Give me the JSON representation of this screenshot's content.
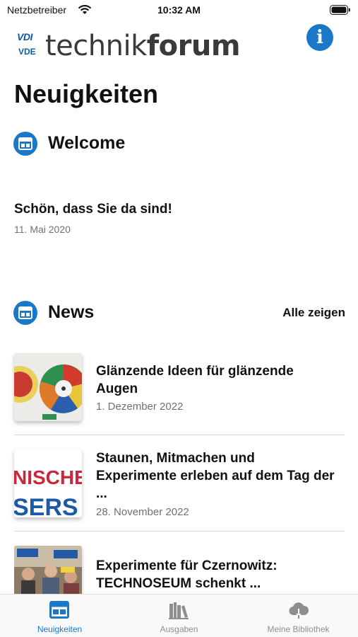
{
  "status_bar": {
    "carrier": "Netzbetreiber",
    "time": "10:32 AM",
    "wifi_icon": "wifi-icon",
    "battery_icon": "battery-icon"
  },
  "header": {
    "logo_vdi": "VDI",
    "logo_vde": "VDE",
    "logo_word_light": "technik",
    "logo_word_bold": "forum",
    "info_icon": "info-icon"
  },
  "page": {
    "title": "Neuigkeiten"
  },
  "welcome": {
    "section_title": "Welcome",
    "section_icon": "layout-grid-icon",
    "heading": "Schön, dass Sie da sind!",
    "date": "11. Mai 2020"
  },
  "news": {
    "section_title": "News",
    "section_icon": "layout-grid-icon",
    "show_all_label": "Alle zeigen",
    "items": [
      {
        "title": "Glänzende Ideen für glänzende Augen",
        "date": "1. Dezember 2022",
        "thumb_text": ""
      },
      {
        "title": "Staunen, Mitmachen und Experimente erleben auf dem Tag der ...",
        "date": "28. November 2022",
        "thumb_text_top": "NISCHE",
        "thumb_text_bottom": "SERS"
      },
      {
        "title": "Experimente für Czernowitz: TECHNOSEUM schenkt ...",
        "date": ""
      }
    ]
  },
  "tab_bar": {
    "tabs": [
      {
        "label": "Neuigkeiten",
        "icon": "newspaper-icon",
        "active": true
      },
      {
        "label": "Ausgaben",
        "icon": "books-icon",
        "active": false
      },
      {
        "label": "Meine Bibliothek",
        "icon": "cloud-download-icon",
        "active": false
      }
    ],
    "active_color": "#1a78c9",
    "inactive_color": "#8e8e8e"
  },
  "colors": {
    "accent": "#1a78c9",
    "logo_blue": "#0a5aa7"
  }
}
